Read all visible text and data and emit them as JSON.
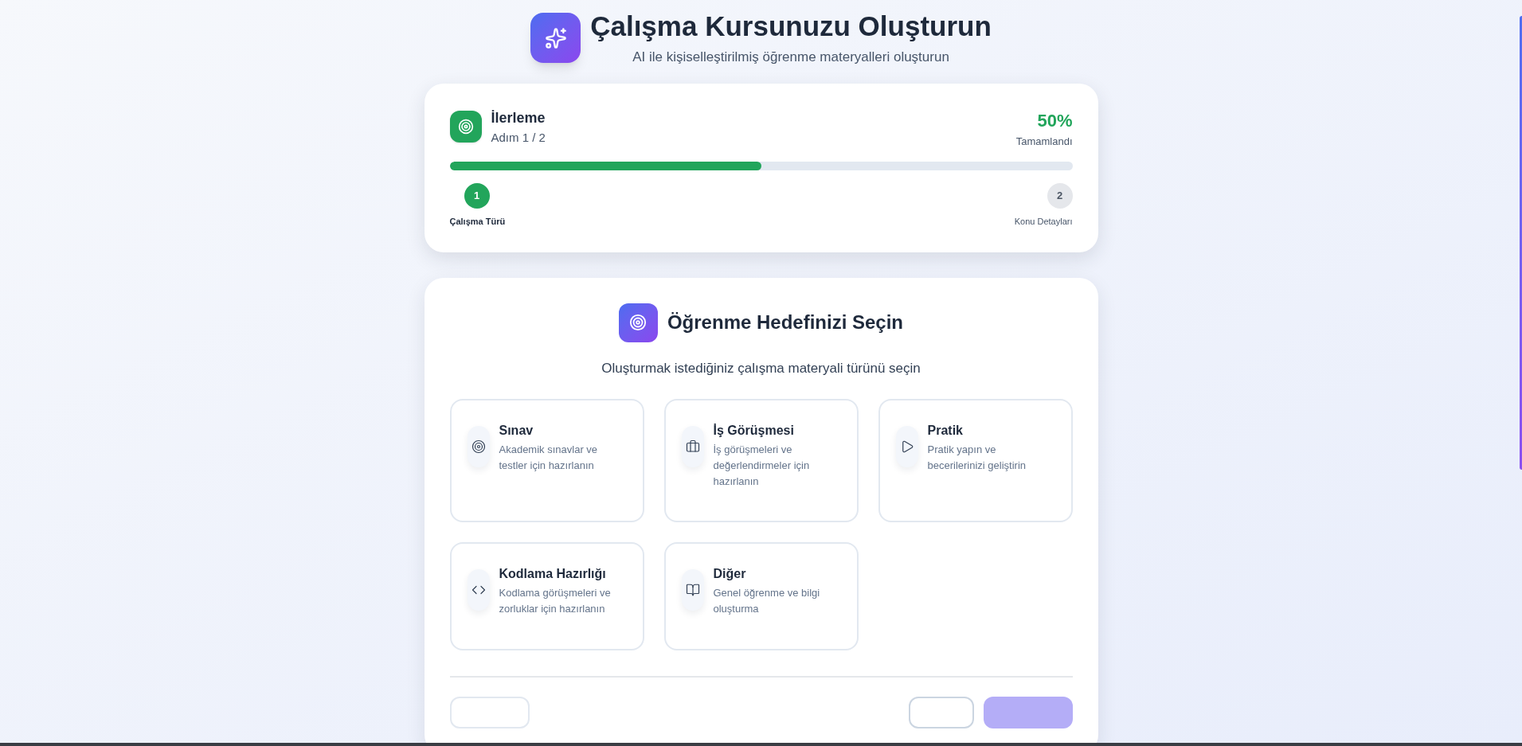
{
  "header": {
    "title": "Çalışma Kursunuzu Oluşturun",
    "subtitle": "AI ile kişiselleştirilmiş öğrenme materyalleri oluşturun"
  },
  "progress": {
    "title": "İlerleme",
    "step_text": "Adım 1 / 2",
    "percent": "50%",
    "percent_label": "Tamamlandı",
    "level": 0.5,
    "steps": [
      {
        "number": "1",
        "label": "Çalışma Türü",
        "active": true
      },
      {
        "number": "2",
        "label": "Konu Detayları",
        "active": false
      }
    ]
  },
  "goal": {
    "title": "Öğrenme Hedefinizi Seçin",
    "subtitle": "Oluşturmak istediğiniz çalışma materyali türünü seçin",
    "options": [
      {
        "kind": "target",
        "title": "Sınav",
        "description": "Akademik sınavlar ve testler için hazırlanın",
        "selected": false
      },
      {
        "kind": "briefcase",
        "title": "İş Görüşmesi",
        "description": "İş görüşmeleri ve değerlendirmeler için hazırlanın",
        "selected": false
      },
      {
        "kind": "play",
        "title": "Pratik",
        "description": "Pratik yapın ve becerilerinizi geliştirin",
        "selected": false
      },
      {
        "kind": "code",
        "title": "Kodlama Hazırlığı",
        "description": "Kodlama görüşmeleri ve zorluklar için hazırlanın",
        "selected": false
      },
      {
        "kind": "book",
        "title": "Diğer",
        "description": "Genel öğrenme ve bilgi oluşturma",
        "selected": false
      }
    ],
    "buttons": [
      {
        "kind": "back"
      },
      {
        "kind": "cancel"
      },
      {
        "kind": "next"
      }
    ]
  }
}
